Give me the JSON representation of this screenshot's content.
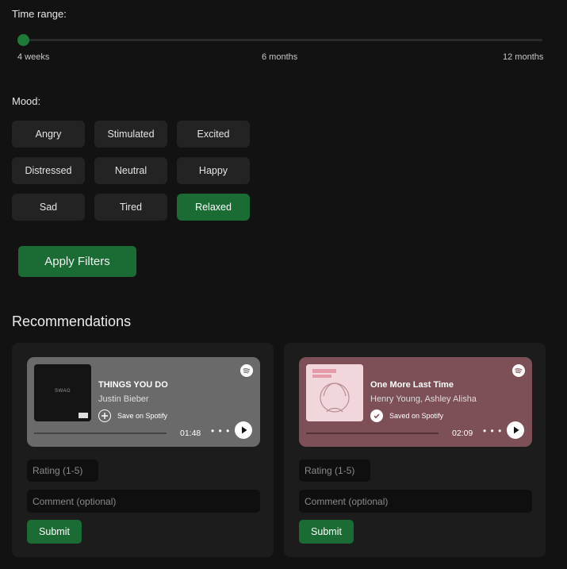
{
  "filters": {
    "time_range": {
      "label": "Time range:",
      "ticks": [
        "4 weeks",
        "6 months",
        "12 months"
      ],
      "selected_value": "4 weeks",
      "position_fraction": 0.0
    },
    "mood": {
      "label": "Mood:",
      "options": [
        "Angry",
        "Stimulated",
        "Excited",
        "Distressed",
        "Neutral",
        "Happy",
        "Sad",
        "Tired",
        "Relaxed"
      ],
      "selected": "Relaxed"
    },
    "apply_label": "Apply Filters"
  },
  "recommendations": {
    "title": "Recommendations",
    "cards": [
      {
        "track": "THINGS YOU DO",
        "artist": "Justin Bieber",
        "save_status": "Save on Spotify",
        "saved": false,
        "duration": "01:48",
        "embed_color": "#6a6a6a",
        "rating_placeholder": "Rating (1-5)",
        "comment_placeholder": "Comment (optional)",
        "submit_label": "Submit"
      },
      {
        "track": "One More Last Time",
        "artist": "Henry Young, Ashley Alisha",
        "save_status": "Saved on Spotify",
        "saved": true,
        "duration": "02:09",
        "embed_color": "#7d4f57",
        "rating_placeholder": "Rating (1-5)",
        "comment_placeholder": "Comment (optional)",
        "submit_label": "Submit"
      }
    ]
  },
  "icons": {
    "spotify": "spotify-logo-icon",
    "save": "plus-circle-icon",
    "saved": "check-circle-icon",
    "more": "more-dots-icon",
    "play": "play-icon"
  },
  "colors": {
    "background": "#121212",
    "accent_green": "#1b6b34",
    "button_gray": "#232323",
    "card_bg": "#1c1c1c"
  }
}
